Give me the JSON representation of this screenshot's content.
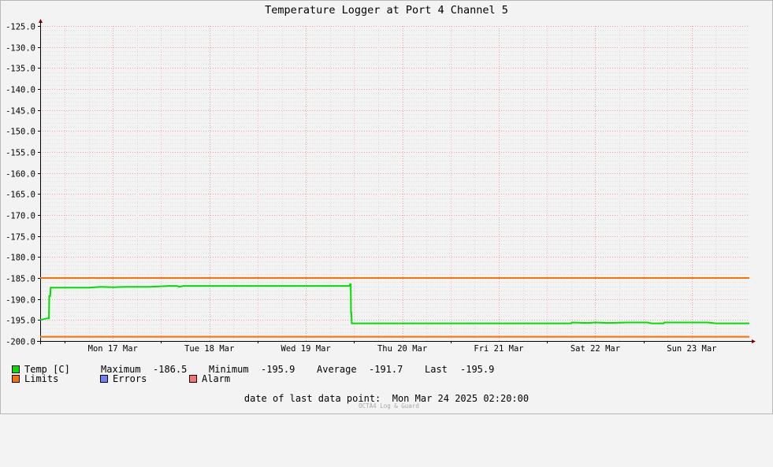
{
  "chart_data": {
    "type": "line",
    "title": "Temperature Logger at Port 4 Channel 5",
    "ylim": [
      -200,
      -125
    ],
    "y_ticks": [
      "-125.0",
      "-130.0",
      "-135.0",
      "-140.0",
      "-145.0",
      "-150.0",
      "-155.0",
      "-160.0",
      "-165.0",
      "-170.0",
      "-175.0",
      "-180.0",
      "-185.0",
      "-190.0",
      "-195.0",
      "-200.0"
    ],
    "y_tick_values": [
      -125,
      -130,
      -135,
      -140,
      -145,
      -150,
      -155,
      -160,
      -165,
      -170,
      -175,
      -180,
      -185,
      -190,
      -195,
      -200
    ],
    "x_range": [
      "2025-03-16 17:55",
      "2025-03-24 02:20"
    ],
    "x_ticks": [
      {
        "label": "Mon 17 Mar",
        "t": "2025-03-17 00:00"
      },
      {
        "label": "Tue 18 Mar",
        "t": "2025-03-18 00:00"
      },
      {
        "label": "Wed 19 Mar",
        "t": "2025-03-19 00:00"
      },
      {
        "label": "Thu 20 Mar",
        "t": "2025-03-20 00:00"
      },
      {
        "label": "Fri 21 Mar",
        "t": "2025-03-21 00:00"
      },
      {
        "label": "Sat 22 Mar",
        "t": "2025-03-22 00:00"
      },
      {
        "label": "Sun 23 Mar",
        "t": "2025-03-23 00:00"
      }
    ],
    "grid": true,
    "limits": [
      -185.0,
      -199.0
    ],
    "series": [
      {
        "name": "Temp [C]",
        "color": "#00e000",
        "points": [
          [
            "2025-03-16 17:55",
            -195.0
          ],
          [
            "2025-03-16 19:40",
            -194.6
          ],
          [
            "2025-03-16 20:05",
            -194.6
          ],
          [
            "2025-03-16 20:10",
            -189.3
          ],
          [
            "2025-03-16 20:25",
            -189.3
          ],
          [
            "2025-03-16 20:30",
            -187.3
          ],
          [
            "2025-03-17 06:00",
            -187.3
          ],
          [
            "2025-03-17 09:00",
            -187.1
          ],
          [
            "2025-03-17 12:00",
            -187.2
          ],
          [
            "2025-03-17 15:00",
            -187.1
          ],
          [
            "2025-03-17 21:00",
            -187.1
          ],
          [
            "2025-03-18 02:00",
            -186.9
          ],
          [
            "2025-03-18 04:00",
            -186.9
          ],
          [
            "2025-03-18 04:30",
            -187.1
          ],
          [
            "2025-03-18 05:30",
            -186.9
          ],
          [
            "2025-03-19 12:00",
            -186.9
          ],
          [
            "2025-03-19 22:55",
            -186.9
          ],
          [
            "2025-03-19 23:00",
            -186.5
          ],
          [
            "2025-03-19 23:10",
            -186.5
          ],
          [
            "2025-03-19 23:15",
            -193.2
          ],
          [
            "2025-03-19 23:20",
            -193.2
          ],
          [
            "2025-03-19 23:25",
            -195.8
          ],
          [
            "2025-03-20 12:00",
            -195.8
          ],
          [
            "2025-03-21 12:00",
            -195.8
          ],
          [
            "2025-03-22 00:00",
            -195.8
          ],
          [
            "2025-03-22 06:00",
            -195.8
          ],
          [
            "2025-03-22 06:10",
            -195.6
          ],
          [
            "2025-03-22 10:00",
            -195.7
          ],
          [
            "2025-03-22 12:00",
            -195.6
          ],
          [
            "2025-03-22 15:00",
            -195.7
          ],
          [
            "2025-03-22 20:00",
            -195.6
          ],
          [
            "2025-03-23 01:00",
            -195.6
          ],
          [
            "2025-03-23 02:00",
            -195.8
          ],
          [
            "2025-03-23 05:00",
            -195.8
          ],
          [
            "2025-03-23 05:10",
            -195.6
          ],
          [
            "2025-03-23 16:00",
            -195.6
          ],
          [
            "2025-03-23 18:00",
            -195.8
          ],
          [
            "2025-03-24 02:20",
            -195.8
          ]
        ]
      }
    ]
  },
  "legend": {
    "temp_label": "Temp [C]",
    "max_label": "Maximum",
    "max_value": "-186.5",
    "min_label": "Minimum",
    "min_value": "-195.9",
    "avg_label": "Average",
    "avg_value": "-191.7",
    "last_label": "Last",
    "last_value": "-195.9",
    "limits_label": "Limits",
    "errors_label": "Errors",
    "alarm_label": "Alarm",
    "colors": {
      "temp": "#00e000",
      "limits": "#ff7000",
      "errors": "#7080ff",
      "alarm": "#ff7070"
    }
  },
  "footer": {
    "last_point_label": "date of last data point:",
    "last_point_value": "Mon Mar 24 2025 02:20:00",
    "watermark": "OCTA4 Log & Guard"
  }
}
